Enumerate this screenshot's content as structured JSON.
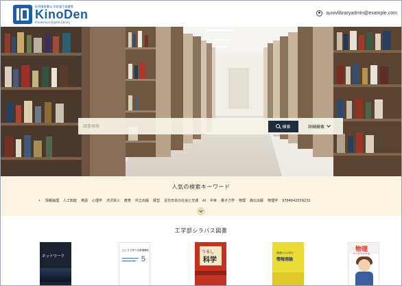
{
  "header": {
    "logo_top": "紀伊國屋書店 学術電子図書館",
    "logo_main": "KinoDen",
    "logo_sub": "Kinokuniya Digital Library",
    "user_email": "aunivlibraryadmin@example.com"
  },
  "search": {
    "placeholder": "図書検索",
    "button_label": "検索",
    "advanced_label": "詳細検索"
  },
  "keywords": {
    "title": "人気の検索キーワード",
    "items": [
      "情報倫理",
      "人工知能",
      "英語",
      "心理学",
      "渋沢栄三",
      "教育",
      "共立出版",
      "経営",
      "近代日本の社会と交通",
      "AI",
      "中世",
      "量子力学",
      "物理",
      "森北出版",
      "物理学",
      "9784642039232"
    ]
  },
  "syllabus": {
    "title": "工学部シラバス図書",
    "books": [
      {
        "title": "ネットワーク"
      },
      {
        "title": "ひとりで学べる数値解析",
        "volume": "5"
      },
      {
        "top": "うるし",
        "main": "科学"
      },
      {
        "top": "基礎からの学び",
        "main": "情報理論"
      },
      {
        "main": "物理",
        "sub": "マンガでわかる"
      }
    ]
  },
  "colors": {
    "brand": "#1c5fa8",
    "search_button": "#1e2b3c",
    "keyword_band": "#fbf4e1"
  }
}
